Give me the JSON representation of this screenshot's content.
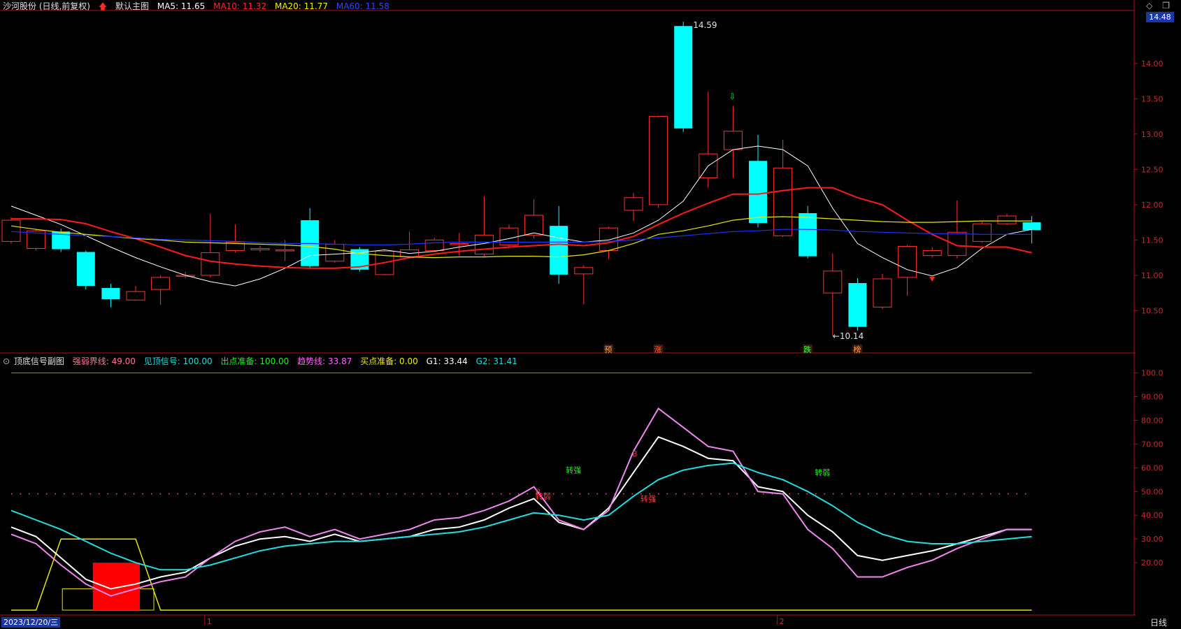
{
  "main_header": {
    "title": "沙河股份 (日线,前复权)",
    "template": "默认主图",
    "ma5": "MA5: 11.65",
    "ma10": "MA10: 11.32",
    "ma20": "MA20: 11.77",
    "ma60": "MA60: 11.58"
  },
  "sub_header": {
    "title": "顶底信号副图",
    "strong_weak": "强弱界线: 49.00",
    "see_top": "见顶信号: 100.00",
    "exit_prep": "出点准备: 100.00",
    "trend": "趋势线: 33.87",
    "buy_prep": "买点准备: 0.00",
    "g1": "G1: 33.44",
    "g2": "G2: 31.41"
  },
  "current_price": "14.48",
  "footer": {
    "date": "2023/12/20/三",
    "period": "日线",
    "month_1": "1",
    "month_2": "2"
  },
  "colors": {
    "up": "#ff3030",
    "down": "#00ffff",
    "ma5": "#ffffff",
    "ma10": "#ff1a1a",
    "ma20": "#e6e600",
    "ma60": "#1a33ff"
  },
  "chart_data": [
    {
      "type": "candlestick",
      "y_axis_ticks": [
        "14.00",
        "13.50",
        "13.00",
        "12.50",
        "12.00",
        "11.50",
        "11.00",
        "10.50"
      ],
      "ylim": [
        9.95,
        14.75
      ],
      "candles": [
        {
          "o": 11.48,
          "c": 11.78,
          "h": 11.82,
          "l": 11.45
        },
        {
          "o": 11.38,
          "c": 11.63,
          "h": 11.66,
          "l": 11.35
        },
        {
          "o": 11.62,
          "c": 11.37,
          "h": 11.66,
          "l": 11.33
        },
        {
          "o": 11.33,
          "c": 10.85,
          "h": 11.35,
          "l": 10.8
        },
        {
          "o": 10.82,
          "c": 10.66,
          "h": 10.88,
          "l": 10.55
        },
        {
          "o": 10.65,
          "c": 10.77,
          "h": 10.85,
          "l": 10.64
        },
        {
          "o": 10.8,
          "c": 10.97,
          "h": 11.0,
          "l": 10.58
        },
        {
          "o": 10.99,
          "c": 11.0,
          "h": 11.05,
          "l": 10.96
        },
        {
          "o": 11.0,
          "c": 11.32,
          "h": 11.87,
          "l": 10.97
        },
        {
          "o": 11.35,
          "c": 11.47,
          "h": 11.72,
          "l": 11.32
        },
        {
          "o": 11.36,
          "c": 11.38,
          "h": 11.42,
          "l": 11.33
        },
        {
          "o": 11.36,
          "c": 11.36,
          "h": 11.5,
          "l": 11.2
        },
        {
          "o": 11.78,
          "c": 11.13,
          "h": 11.95,
          "l": 11.1
        },
        {
          "o": 11.2,
          "c": 11.44,
          "h": 11.5,
          "l": 11.18
        },
        {
          "o": 11.37,
          "c": 11.08,
          "h": 11.4,
          "l": 11.05
        },
        {
          "o": 11.01,
          "c": 11.34,
          "h": 11.36,
          "l": 11.0
        },
        {
          "o": 11.26,
          "c": 11.36,
          "h": 11.62,
          "l": 11.25
        },
        {
          "o": 11.35,
          "c": 11.5,
          "h": 11.53,
          "l": 11.33
        },
        {
          "o": 11.45,
          "c": 11.45,
          "h": 11.6,
          "l": 11.28
        },
        {
          "o": 11.3,
          "c": 11.57,
          "h": 12.12,
          "l": 11.25
        },
        {
          "o": 11.43,
          "c": 11.67,
          "h": 11.72,
          "l": 11.38
        },
        {
          "o": 11.57,
          "c": 11.85,
          "h": 12.08,
          "l": 11.52
        },
        {
          "o": 11.7,
          "c": 11.01,
          "h": 11.98,
          "l": 10.88
        },
        {
          "o": 11.02,
          "c": 11.11,
          "h": 11.14,
          "l": 10.59
        },
        {
          "o": 11.35,
          "c": 11.67,
          "h": 11.69,
          "l": 11.23
        },
        {
          "o": 11.92,
          "c": 12.1,
          "h": 12.17,
          "l": 11.77
        },
        {
          "o": 12.0,
          "c": 13.25,
          "h": 13.26,
          "l": 11.96
        },
        {
          "o": 14.53,
          "c": 13.08,
          "h": 14.59,
          "l": 13.03
        },
        {
          "o": 12.38,
          "c": 12.72,
          "h": 13.6,
          "l": 12.24
        },
        {
          "o": 12.78,
          "c": 13.04,
          "h": 13.4,
          "l": 12.38
        },
        {
          "o": 12.62,
          "c": 11.74,
          "h": 12.99,
          "l": 11.68
        },
        {
          "o": 11.56,
          "c": 12.52,
          "h": 12.92,
          "l": 11.54
        },
        {
          "o": 11.88,
          "c": 11.27,
          "h": 11.98,
          "l": 11.24
        },
        {
          "o": 10.75,
          "c": 11.06,
          "h": 11.31,
          "l": 10.14
        },
        {
          "o": 10.89,
          "c": 10.27,
          "h": 10.96,
          "l": 10.22
        },
        {
          "o": 10.55,
          "c": 10.95,
          "h": 11.02,
          "l": 10.52
        },
        {
          "o": 10.97,
          "c": 11.41,
          "h": 11.43,
          "l": 10.71
        },
        {
          "o": 11.28,
          "c": 11.35,
          "h": 11.4,
          "l": 11.25
        },
        {
          "o": 11.28,
          "c": 11.61,
          "h": 12.06,
          "l": 11.24
        },
        {
          "o": 11.48,
          "c": 11.73,
          "h": 11.76,
          "l": 11.46
        },
        {
          "o": 11.73,
          "c": 11.84,
          "h": 11.87,
          "l": 11.71
        },
        {
          "o": 11.75,
          "c": 11.64,
          "h": 11.84,
          "l": 11.45
        }
      ],
      "series": [
        {
          "name": "MA5",
          "values": [
            11.98,
            11.85,
            11.72,
            11.56,
            11.4,
            11.25,
            11.12,
            11.0,
            10.91,
            10.85,
            10.95,
            11.1,
            11.28,
            11.3,
            11.32,
            11.36,
            11.31,
            11.34,
            11.4,
            11.45,
            11.52,
            11.6,
            11.53,
            11.47,
            11.5,
            11.6,
            11.78,
            12.05,
            12.55,
            12.78,
            12.83,
            12.78,
            12.55,
            11.95,
            11.45,
            11.25,
            11.08,
            10.99,
            11.11,
            11.38,
            11.58,
            11.65
          ]
        },
        {
          "name": "MA10",
          "values": [
            11.8,
            11.8,
            11.79,
            11.73,
            11.62,
            11.52,
            11.4,
            11.28,
            11.2,
            11.16,
            11.13,
            11.11,
            11.1,
            11.1,
            11.12,
            11.18,
            11.25,
            11.3,
            11.34,
            11.37,
            11.4,
            11.42,
            11.44,
            11.42,
            11.46,
            11.55,
            11.72,
            11.88,
            12.02,
            12.15,
            12.15,
            12.2,
            12.24,
            12.24,
            12.1,
            12.0,
            11.78,
            11.58,
            11.42,
            11.4,
            11.4,
            11.32
          ]
        },
        {
          "name": "MA20",
          "values": [
            11.7,
            11.65,
            11.61,
            11.58,
            11.55,
            11.52,
            11.5,
            11.47,
            11.46,
            11.45,
            11.44,
            11.43,
            11.41,
            11.37,
            11.31,
            11.28,
            11.26,
            11.25,
            11.26,
            11.26,
            11.27,
            11.27,
            11.26,
            11.29,
            11.35,
            11.45,
            11.58,
            11.63,
            11.7,
            11.78,
            11.82,
            11.83,
            11.82,
            11.8,
            11.78,
            11.76,
            11.75,
            11.75,
            11.76,
            11.77,
            11.77,
            11.77
          ]
        },
        {
          "name": "MA60",
          "values": [
            11.62,
            11.6,
            11.58,
            11.56,
            11.55,
            11.53,
            11.51,
            11.5,
            11.49,
            11.48,
            11.46,
            11.45,
            11.45,
            11.44,
            11.43,
            11.43,
            11.44,
            11.46,
            11.47,
            11.47,
            11.47,
            11.47,
            11.47,
            11.47,
            11.48,
            11.5,
            11.53,
            11.56,
            11.59,
            11.62,
            11.63,
            11.65,
            11.65,
            11.64,
            11.62,
            11.61,
            11.6,
            11.59,
            11.59,
            11.58,
            11.58,
            11.58
          ]
        }
      ],
      "annotations": {
        "high_label": "14.59",
        "low_label": "←10.14",
        "markers": [
          "预",
          "涨",
          "跌",
          "榜"
        ]
      }
    },
    {
      "type": "line",
      "y_axis_ticks": [
        "100.0",
        "90.00",
        "80.00",
        "70.00",
        "60.00",
        "50.00",
        "40.00",
        "30.00",
        "20.00"
      ],
      "ylim": [
        0,
        104
      ],
      "series": [
        {
          "name": "趋势线",
          "values": [
            35,
            31,
            22,
            13,
            9,
            11,
            14,
            16,
            22,
            27,
            30,
            31,
            29,
            32,
            29,
            30,
            31,
            34,
            35,
            38,
            43,
            47,
            37,
            34,
            43,
            58,
            73,
            69,
            64,
            63,
            52,
            50,
            40,
            33,
            23,
            21,
            23,
            25,
            28,
            31,
            34,
            34
          ]
        },
        {
          "name": "G1",
          "values": [
            32,
            28,
            19,
            11,
            6,
            9,
            12,
            14,
            22,
            29,
            33,
            35,
            31,
            34,
            30,
            32,
            34,
            38,
            39,
            42,
            46,
            52,
            38,
            34,
            42,
            67,
            85,
            77,
            69,
            67,
            50,
            49,
            34,
            26,
            14,
            14,
            18,
            21,
            26,
            30,
            34,
            34
          ]
        },
        {
          "name": "G2",
          "values": [
            42,
            38,
            34,
            29,
            24,
            20,
            17,
            17,
            19,
            22,
            25,
            27,
            28,
            29,
            29,
            30,
            31,
            32,
            33,
            35,
            38,
            41,
            40,
            38,
            40,
            48,
            55,
            59,
            61,
            62,
            58,
            55,
            50,
            44,
            37,
            32,
            29,
            28,
            28,
            29,
            30,
            31
          ]
        }
      ],
      "strong_weak_line": 49,
      "see_top_line": 100,
      "buy_prep": [
        0,
        0,
        30,
        30,
        30,
        30,
        0,
        0,
        0,
        0,
        0,
        0,
        0,
        0,
        0,
        0,
        0,
        0,
        0,
        0,
        0,
        0,
        0,
        0,
        0,
        0,
        0,
        0,
        0,
        0,
        0,
        0,
        0,
        0,
        0,
        0,
        0,
        0,
        0,
        0,
        0,
        0
      ],
      "labels": [
        "转弱",
        "转强",
        "转强",
        "转弱",
        "B",
        "B"
      ]
    }
  ]
}
